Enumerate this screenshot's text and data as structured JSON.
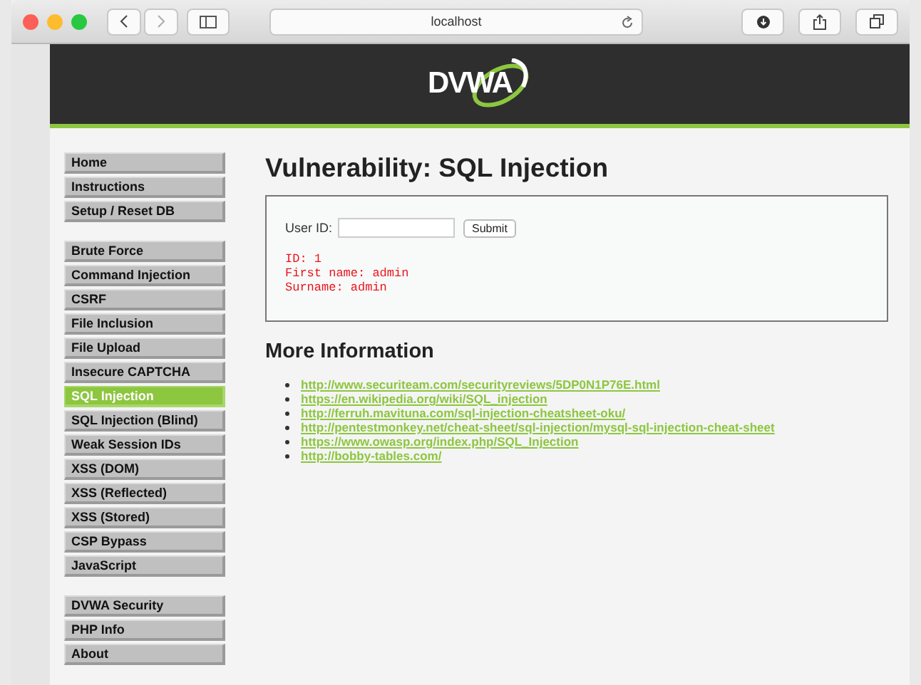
{
  "browser": {
    "address": "localhost"
  },
  "logo": {
    "text": "DVWA"
  },
  "menu": [
    {
      "items": [
        {
          "label": "Home",
          "selected": false
        },
        {
          "label": "Instructions",
          "selected": false
        },
        {
          "label": "Setup / Reset DB",
          "selected": false
        }
      ]
    },
    {
      "items": [
        {
          "label": "Brute Force",
          "selected": false
        },
        {
          "label": "Command Injection",
          "selected": false
        },
        {
          "label": "CSRF",
          "selected": false
        },
        {
          "label": "File Inclusion",
          "selected": false
        },
        {
          "label": "File Upload",
          "selected": false
        },
        {
          "label": "Insecure CAPTCHA",
          "selected": false
        },
        {
          "label": "SQL Injection",
          "selected": true
        },
        {
          "label": "SQL Injection (Blind)",
          "selected": false
        },
        {
          "label": "Weak Session IDs",
          "selected": false
        },
        {
          "label": "XSS (DOM)",
          "selected": false
        },
        {
          "label": "XSS (Reflected)",
          "selected": false
        },
        {
          "label": "XSS (Stored)",
          "selected": false
        },
        {
          "label": "CSP Bypass",
          "selected": false
        },
        {
          "label": "JavaScript",
          "selected": false
        }
      ]
    },
    {
      "items": [
        {
          "label": "DVWA Security",
          "selected": false
        },
        {
          "label": "PHP Info",
          "selected": false
        },
        {
          "label": "About",
          "selected": false
        }
      ]
    }
  ],
  "title": "Vulnerability: SQL Injection",
  "form": {
    "label": "User ID:",
    "button": "Submit",
    "output": [
      "ID: 1",
      "First name: admin",
      "Surname: admin"
    ]
  },
  "more_info": {
    "heading": "More Information",
    "links": [
      "http://www.securiteam.com/securityreviews/5DP0N1P76E.html",
      "https://en.wikipedia.org/wiki/SQL_injection",
      "http://ferruh.mavituna.com/sql-injection-cheatsheet-oku/",
      "http://pentestmonkey.net/cheat-sheet/sql-injection/mysql-sql-injection-cheat-sheet",
      "https://www.owasp.org/index.php/SQL_Injection",
      "http://bobby-tables.com/"
    ]
  }
}
